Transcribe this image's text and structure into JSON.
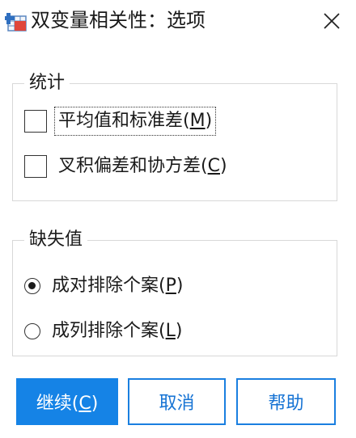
{
  "dialog": {
    "title": "双变量相关性：选项",
    "close_glyph": "✕"
  },
  "statistics": {
    "legend": "统计",
    "options": [
      {
        "label": "平均值和标准差",
        "mnemonic": "M",
        "checked": false,
        "focused": true
      },
      {
        "label": "叉积偏差和协方差",
        "mnemonic": "C",
        "checked": false,
        "focused": false
      }
    ]
  },
  "missing": {
    "legend": "缺失值",
    "options": [
      {
        "label": "成对排除个案",
        "mnemonic": "P",
        "selected": true
      },
      {
        "label": "成列排除个案",
        "mnemonic": "L",
        "selected": false
      }
    ]
  },
  "buttons": {
    "continue": {
      "label": "继续",
      "mnemonic": "C"
    },
    "cancel": {
      "label": "取消"
    },
    "help": {
      "label": "帮助"
    }
  },
  "colors": {
    "primary": "#1583e6",
    "secondary_text": "#1673d4",
    "border": "#d8d8d8"
  },
  "icons": {
    "app": "spss-app-icon",
    "close": "close-icon"
  }
}
